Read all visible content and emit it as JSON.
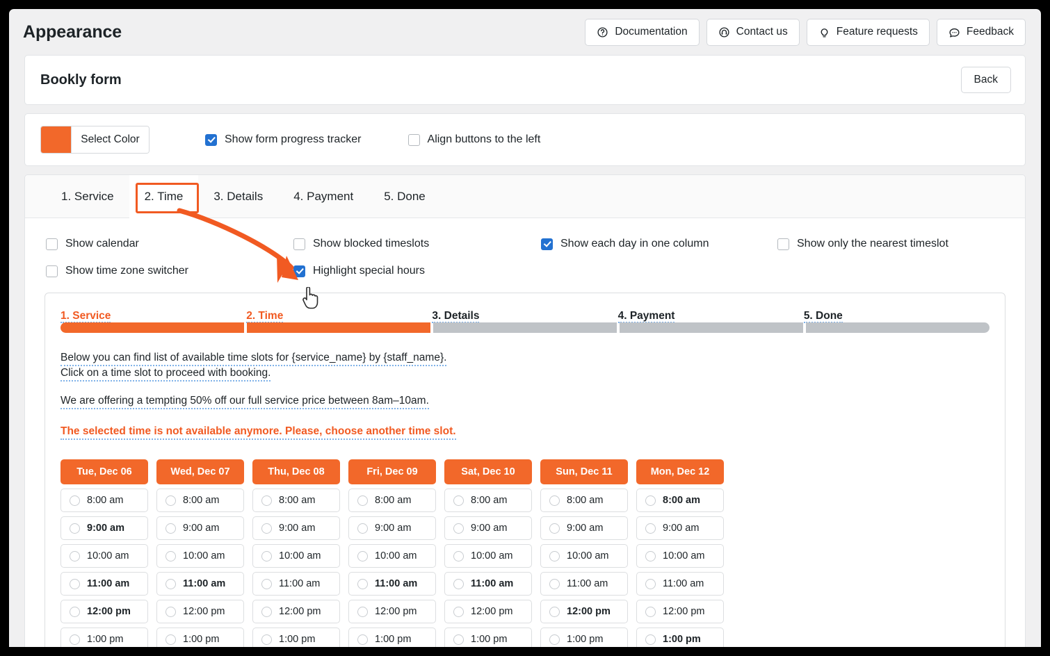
{
  "header": {
    "title": "Appearance",
    "actions": [
      {
        "label": "Documentation",
        "icon": "question-circle-icon"
      },
      {
        "label": "Contact us",
        "icon": "headset-icon"
      },
      {
        "label": "Feature requests",
        "icon": "lightbulb-icon"
      },
      {
        "label": "Feedback",
        "icon": "chat-bubble-icon"
      }
    ]
  },
  "form_header": {
    "title": "Bookly form",
    "back_label": "Back"
  },
  "settings": {
    "color_label": "Select Color",
    "color_value": "#f2682a",
    "show_progress_tracker": {
      "label": "Show form progress tracker",
      "checked": true
    },
    "align_buttons_left": {
      "label": "Align buttons to the left",
      "checked": false
    }
  },
  "tabs": [
    {
      "label": "1. Service",
      "active": false
    },
    {
      "label": "2. Time",
      "active": true
    },
    {
      "label": "3. Details",
      "active": false
    },
    {
      "label": "4. Payment",
      "active": false
    },
    {
      "label": "5. Done",
      "active": false
    }
  ],
  "options": [
    {
      "label": "Show calendar",
      "checked": false
    },
    {
      "label": "Show blocked timeslots",
      "checked": false
    },
    {
      "label": "Show each day in one column",
      "checked": true
    },
    {
      "label": "Show only the nearest timeslot",
      "checked": false
    },
    {
      "label": "Show time zone switcher",
      "checked": false
    },
    {
      "label": "Highlight special hours",
      "checked": true
    }
  ],
  "preview": {
    "steps": [
      {
        "label": "1. Service",
        "done": true,
        "current": true
      },
      {
        "label": "2. Time",
        "done": true,
        "current": true
      },
      {
        "label": "3. Details",
        "done": false,
        "current": false
      },
      {
        "label": "4. Payment",
        "done": false,
        "current": false
      },
      {
        "label": "5. Done",
        "done": false,
        "current": false
      }
    ],
    "intro_line1": "Below you can find list of available time slots for {service_name} by {staff_name}.",
    "intro_line2": "Click on a time slot to proceed with booking.",
    "promo": "We are offering a tempting 50% off our full service price between 8am–10am.",
    "error": "The selected time is not available anymore. Please, choose another time slot.",
    "columns": [
      {
        "day": "Tue, Dec 06",
        "slots": [
          {
            "time": "8:00 am",
            "highlight": false
          },
          {
            "time": "9:00 am",
            "highlight": true
          },
          {
            "time": "10:00 am",
            "highlight": false
          },
          {
            "time": "11:00 am",
            "highlight": true
          },
          {
            "time": "12:00 pm",
            "highlight": true
          },
          {
            "time": "1:00 pm",
            "highlight": false
          }
        ]
      },
      {
        "day": "Wed, Dec 07",
        "slots": [
          {
            "time": "8:00 am",
            "highlight": false
          },
          {
            "time": "9:00 am",
            "highlight": false
          },
          {
            "time": "10:00 am",
            "highlight": false
          },
          {
            "time": "11:00 am",
            "highlight": true
          },
          {
            "time": "12:00 pm",
            "highlight": false
          },
          {
            "time": "1:00 pm",
            "highlight": false
          }
        ]
      },
      {
        "day": "Thu, Dec 08",
        "slots": [
          {
            "time": "8:00 am",
            "highlight": false
          },
          {
            "time": "9:00 am",
            "highlight": false
          },
          {
            "time": "10:00 am",
            "highlight": false
          },
          {
            "time": "11:00 am",
            "highlight": false
          },
          {
            "time": "12:00 pm",
            "highlight": false
          },
          {
            "time": "1:00 pm",
            "highlight": false
          }
        ]
      },
      {
        "day": "Fri, Dec 09",
        "slots": [
          {
            "time": "8:00 am",
            "highlight": false
          },
          {
            "time": "9:00 am",
            "highlight": false
          },
          {
            "time": "10:00 am",
            "highlight": false
          },
          {
            "time": "11:00 am",
            "highlight": true
          },
          {
            "time": "12:00 pm",
            "highlight": false
          },
          {
            "time": "1:00 pm",
            "highlight": false
          }
        ]
      },
      {
        "day": "Sat, Dec 10",
        "slots": [
          {
            "time": "8:00 am",
            "highlight": false
          },
          {
            "time": "9:00 am",
            "highlight": false
          },
          {
            "time": "10:00 am",
            "highlight": false
          },
          {
            "time": "11:00 am",
            "highlight": true
          },
          {
            "time": "12:00 pm",
            "highlight": false
          },
          {
            "time": "1:00 pm",
            "highlight": false
          }
        ]
      },
      {
        "day": "Sun, Dec 11",
        "slots": [
          {
            "time": "8:00 am",
            "highlight": false
          },
          {
            "time": "9:00 am",
            "highlight": false
          },
          {
            "time": "10:00 am",
            "highlight": false
          },
          {
            "time": "11:00 am",
            "highlight": false
          },
          {
            "time": "12:00 pm",
            "highlight": true
          },
          {
            "time": "1:00 pm",
            "highlight": false
          }
        ]
      },
      {
        "day": "Mon, Dec 12",
        "slots": [
          {
            "time": "8:00 am",
            "highlight": true
          },
          {
            "time": "9:00 am",
            "highlight": false
          },
          {
            "time": "10:00 am",
            "highlight": false
          },
          {
            "time": "11:00 am",
            "highlight": false
          },
          {
            "time": "12:00 pm",
            "highlight": false
          },
          {
            "time": "1:00 pm",
            "highlight": true
          }
        ]
      }
    ]
  },
  "annotations": {
    "accent_color": "#f15a22",
    "highlighted_tab": "2. Time",
    "arrow_target": "Highlight special hours"
  }
}
